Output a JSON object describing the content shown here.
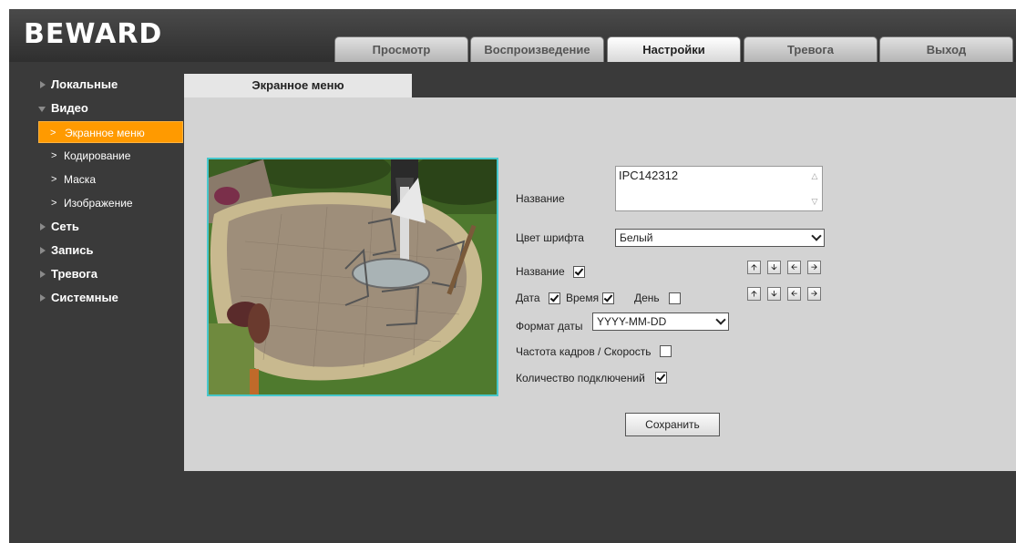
{
  "brand": {
    "logo": "BEWARD"
  },
  "tabs": [
    {
      "label": "Просмотр",
      "active": false
    },
    {
      "label": "Воспроизведение",
      "active": false
    },
    {
      "label": "Настройки",
      "active": true
    },
    {
      "label": "Тревога",
      "active": false
    },
    {
      "label": "Выход",
      "active": false
    }
  ],
  "sidebar": {
    "items": [
      {
        "label": "Локальные"
      },
      {
        "label": "Видео"
      },
      {
        "label": "Экранное меню"
      },
      {
        "label": "Кодирование"
      },
      {
        "label": "Маска"
      },
      {
        "label": "Изображение"
      },
      {
        "label": "Сеть"
      },
      {
        "label": "Запись"
      },
      {
        "label": "Тревога"
      },
      {
        "label": "Системные"
      }
    ],
    "active_item": "Экранное меню"
  },
  "content": {
    "tab_title": "Экранное меню",
    "name_label": "Название",
    "name_value": "IPC142312",
    "font_color_label": "Цвет шрифта",
    "font_color_value": "Белый",
    "show_name_label": "Название",
    "show_name_checked": true,
    "date_label": "Дата",
    "date_checked": true,
    "time_label": "Время",
    "time_checked": true,
    "day_label": "День",
    "day_checked": false,
    "date_format_label": "Формат даты",
    "date_format_value": "YYYY-MM-DD",
    "fps_label": "Частота кадров / Скорость",
    "fps_checked": false,
    "connections_label": "Количество подключений",
    "connections_checked": true,
    "save_label": "Сохранить",
    "arrow_icons": [
      "arrow-up-icon",
      "arrow-down-icon",
      "arrow-left-icon",
      "arrow-right-icon"
    ]
  },
  "colors": {
    "accent": "#ff9a00",
    "background": "#3a3a3a",
    "panel": "#d3d3d3",
    "preview_border": "#46c7cc"
  }
}
